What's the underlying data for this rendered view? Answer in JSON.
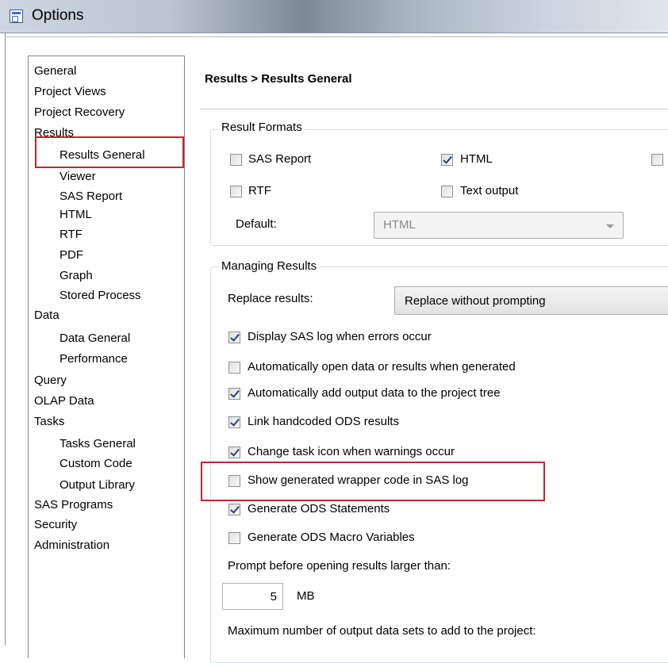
{
  "window": {
    "title": "Options"
  },
  "tree": {
    "items": [
      {
        "label": "General",
        "indent": 0
      },
      {
        "label": "Project Views",
        "indent": 0
      },
      {
        "label": "Project Recovery",
        "indent": 0
      },
      {
        "label": "Results",
        "indent": 0
      },
      {
        "label": "Results General",
        "indent": 1,
        "selected": true
      },
      {
        "label": "Viewer",
        "indent": 1
      },
      {
        "label": "SAS Report",
        "indent": 1
      },
      {
        "label": "HTML",
        "indent": 1
      },
      {
        "label": "RTF",
        "indent": 1
      },
      {
        "label": "PDF",
        "indent": 1
      },
      {
        "label": "Graph",
        "indent": 1
      },
      {
        "label": "Stored Process",
        "indent": 1
      },
      {
        "label": "Data",
        "indent": 0
      },
      {
        "label": "Data General",
        "indent": 1
      },
      {
        "label": "Performance",
        "indent": 1
      },
      {
        "label": "Query",
        "indent": 0
      },
      {
        "label": "OLAP Data",
        "indent": 0
      },
      {
        "label": "Tasks",
        "indent": 0
      },
      {
        "label": "Tasks General",
        "indent": 1
      },
      {
        "label": "Custom Code",
        "indent": 1
      },
      {
        "label": "Output Library",
        "indent": 1
      },
      {
        "label": "SAS Programs",
        "indent": 0
      },
      {
        "label": "Security",
        "indent": 0
      },
      {
        "label": "Administration",
        "indent": 0
      }
    ]
  },
  "page": {
    "heading": "Results > Results General"
  },
  "result_formats": {
    "title": "Result Formats",
    "sas_report": {
      "label": "SAS Report",
      "checked": false
    },
    "html": {
      "label": "HTML",
      "checked": true
    },
    "pdf": {
      "checked": false
    },
    "rtf": {
      "label": "RTF",
      "checked": false
    },
    "text_output": {
      "label": "Text output",
      "checked": false
    },
    "default_label": "Default:",
    "default_value": "HTML"
  },
  "managing_results": {
    "title": "Managing Results",
    "replace_label": "Replace results:",
    "replace_value": "Replace without prompting",
    "options": [
      {
        "label": "Display SAS log when errors occur",
        "checked": true
      },
      {
        "label": "Automatically open data or results when generated",
        "checked": false
      },
      {
        "label": "Automatically add output data to the project tree",
        "checked": true
      },
      {
        "label": "Link handcoded ODS results",
        "checked": true
      },
      {
        "label": "Change task icon when warnings occur",
        "checked": true
      },
      {
        "label": "Show generated wrapper code in SAS log",
        "checked": false
      },
      {
        "label": "Generate ODS Statements",
        "checked": true
      },
      {
        "label": "Generate ODS Macro Variables",
        "checked": false
      }
    ],
    "prompt_label": "Prompt before opening results larger than:",
    "size_value": "5",
    "size_unit": "MB",
    "max_label": "Maximum number of output data sets to add to the project:"
  },
  "colors": {
    "highlight_box": "#c0282d",
    "check_mark": "#2c3e8a"
  }
}
